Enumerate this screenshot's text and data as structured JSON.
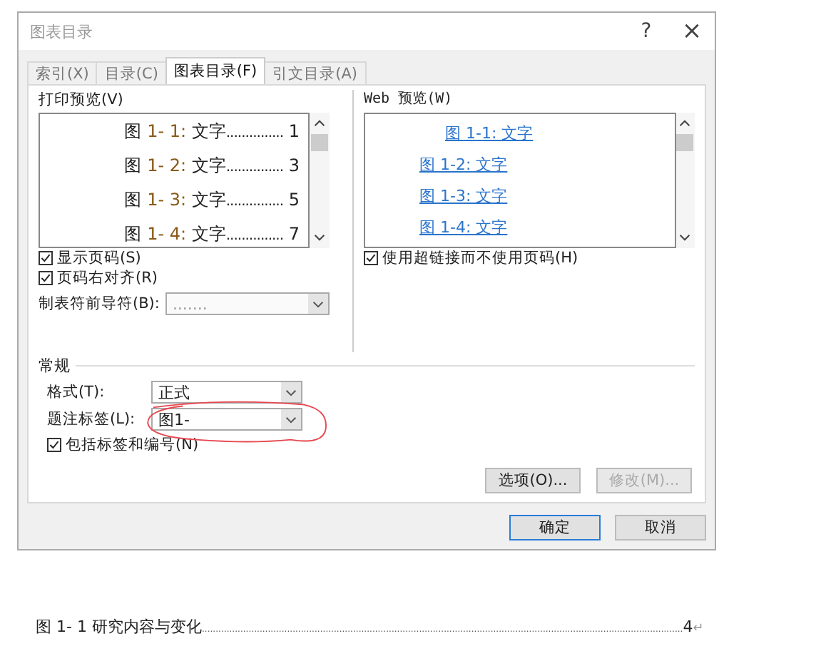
{
  "window": {
    "title": "图表目录",
    "help": "?",
    "close": "×"
  },
  "tabs": [
    {
      "label": "索引(X)",
      "selected": false
    },
    {
      "label": "目录(C)",
      "selected": false
    },
    {
      "label": "图表目录(F)",
      "selected": true
    },
    {
      "label": "引文目录(A)",
      "selected": false
    }
  ],
  "print_preview": {
    "label": "打印预览(V)",
    "entries": [
      {
        "prefix": "图",
        "number": "1- 1:",
        "text": "文字",
        "dots": "...............",
        "page": "1"
      },
      {
        "prefix": "图",
        "number": "1- 2:",
        "text": "文字",
        "dots": "...............",
        "page": "3"
      },
      {
        "prefix": "图",
        "number": "1- 3:",
        "text": "文字",
        "dots": "...............",
        "page": "5"
      },
      {
        "prefix": "图",
        "number": "1- 4:",
        "text": "文字",
        "dots": "...............",
        "page": "7"
      }
    ]
  },
  "web_preview": {
    "label": "Web 预览(W)",
    "links": [
      "图 1-1: 文字",
      "图 1-2: 文字",
      "图 1-3: 文字",
      "图 1-4: 文字"
    ]
  },
  "options": [
    {
      "label": "显示页码(S)",
      "checked": true
    },
    {
      "label": "页码右对齐(R)",
      "checked": true
    }
  ],
  "web_option": {
    "label": "使用超链接而不使用页码(H)",
    "checked": true
  },
  "leader": {
    "label": "制表符前导符(B):",
    "value": ".......",
    "disabled": true
  },
  "general": {
    "title": "常规",
    "format": {
      "label": "格式(T):",
      "value": "正式"
    },
    "caption": {
      "label": "题注标签(L):",
      "value": "图1-"
    },
    "include": {
      "label": "包括标签和编号(N)",
      "checked": true
    }
  },
  "buttons": [
    {
      "label": "选项(O)...",
      "disabled": false
    },
    {
      "label": "修改(M)...",
      "disabled": true
    }
  ],
  "footer_buttons": [
    {
      "label": "确定",
      "default": true
    },
    {
      "label": "取消",
      "default": false
    }
  ],
  "document": {
    "entry": "图 1- 1 研究内容与变化",
    "dots": "...............................................................................................................................................................................",
    "page": "4",
    "mark": "↵"
  }
}
